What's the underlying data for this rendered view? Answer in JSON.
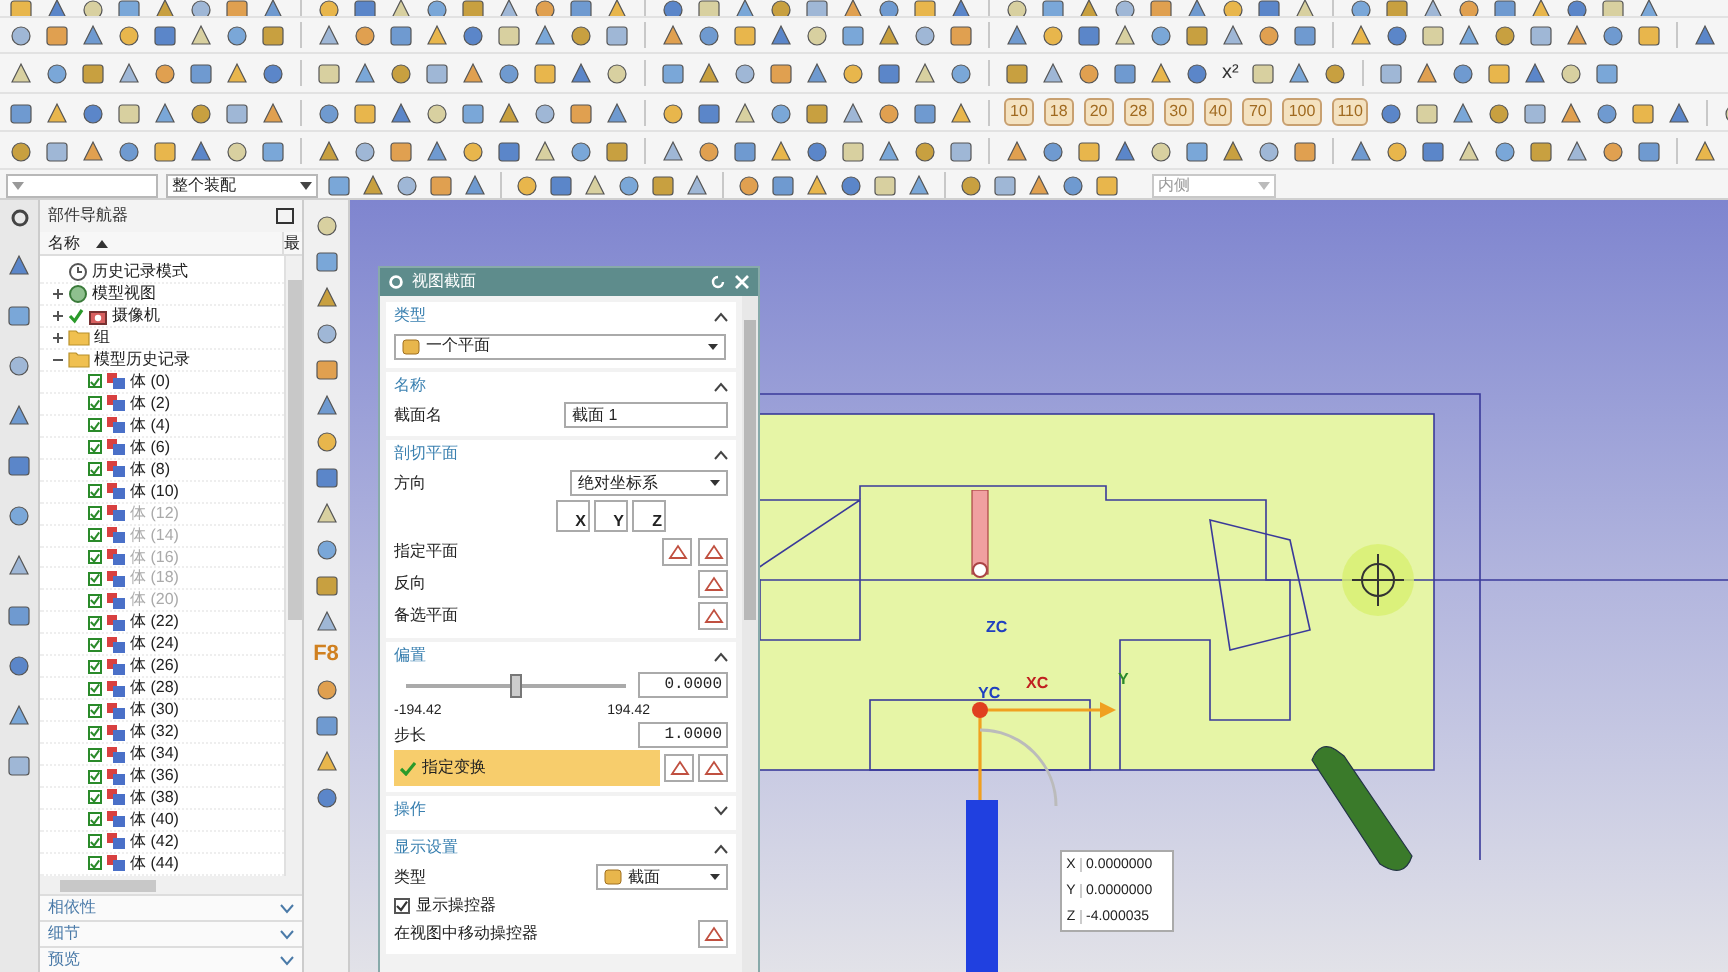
{
  "toolbars": {
    "number_buttons": [
      "10",
      "18",
      "20",
      "28",
      "30",
      "40",
      "70",
      "100",
      "110"
    ],
    "power_button": "x²"
  },
  "filter_bar": {
    "scope": "整个装配",
    "placement": "内侧"
  },
  "part_navigator": {
    "title": "部件导航器",
    "columns": [
      "名称",
      "最"
    ],
    "items": [
      {
        "label": "历史记录模式",
        "kind": "mode"
      },
      {
        "label": "模型视图",
        "kind": "views",
        "expanded": false
      },
      {
        "label": "摄像机",
        "kind": "camera",
        "expanded": false,
        "checked": true
      },
      {
        "label": "组",
        "kind": "folder",
        "expanded": false
      },
      {
        "label": "模型历史记录",
        "kind": "folder",
        "expanded": true,
        "children": [
          {
            "label": "体 (0)",
            "checked": true,
            "dimmed": false
          },
          {
            "label": "体 (2)",
            "checked": true,
            "dimmed": false
          },
          {
            "label": "体 (4)",
            "checked": true,
            "dimmed": false
          },
          {
            "label": "体 (6)",
            "checked": true,
            "dimmed": false
          },
          {
            "label": "体 (8)",
            "checked": true,
            "dimmed": false
          },
          {
            "label": "体 (10)",
            "checked": true,
            "dimmed": false
          },
          {
            "label": "体 (12)",
            "checked": true,
            "dimmed": true
          },
          {
            "label": "体 (14)",
            "checked": true,
            "dimmed": true
          },
          {
            "label": "体 (16)",
            "checked": true,
            "dimmed": true
          },
          {
            "label": "体 (18)",
            "checked": true,
            "dimmed": true
          },
          {
            "label": "体 (20)",
            "checked": true,
            "dimmed": true
          },
          {
            "label": "体 (22)",
            "checked": true,
            "dimmed": false
          },
          {
            "label": "体 (24)",
            "checked": true,
            "dimmed": false
          },
          {
            "label": "体 (26)",
            "checked": true,
            "dimmed": false
          },
          {
            "label": "体 (28)",
            "checked": true,
            "dimmed": false
          },
          {
            "label": "体 (30)",
            "checked": true,
            "dimmed": false
          },
          {
            "label": "体 (32)",
            "checked": true,
            "dimmed": false
          },
          {
            "label": "体 (34)",
            "checked": true,
            "dimmed": false
          },
          {
            "label": "体 (36)",
            "checked": true,
            "dimmed": false
          },
          {
            "label": "体 (38)",
            "checked": true,
            "dimmed": false
          },
          {
            "label": "体 (40)",
            "checked": true,
            "dimmed": false
          },
          {
            "label": "体 (42)",
            "checked": true,
            "dimmed": false
          },
          {
            "label": "体 (44)",
            "checked": true,
            "dimmed": false
          }
        ]
      }
    ],
    "panels": [
      {
        "label": "相依性",
        "expanded": false
      },
      {
        "label": "细节",
        "expanded": false
      },
      {
        "label": "预览",
        "expanded": false
      }
    ]
  },
  "vertical_toolbar": {
    "function_key": "F8"
  },
  "dialog": {
    "title": "视图截面",
    "type_section": {
      "title": "类型",
      "expanded": true,
      "value": "一个平面"
    },
    "name_section": {
      "title": "名称",
      "expanded": true,
      "label": "截面名",
      "value": "截面 1"
    },
    "plane_section": {
      "title": "剖切平面",
      "expanded": true,
      "orientation_label": "方向",
      "orientation": "绝对坐标系",
      "axes": [
        "X",
        "Y",
        "Z"
      ],
      "specify_plane": "指定平面",
      "reverse": "反向",
      "alternate_plane": "备选平面"
    },
    "offset_section": {
      "title": "偏置",
      "expanded": true,
      "level": 0.5,
      "value": "0.0000",
      "min": "-194.42",
      "max": "194.42",
      "step_label": "步长",
      "step": "1.0000",
      "transform": "指定变换",
      "transform_done": true
    },
    "operation_section": {
      "title": "操作",
      "expanded": false
    },
    "display_section": {
      "title": "显示设置",
      "expanded": true,
      "type_label": "类型",
      "type_value": "截面",
      "show_manipulator": "显示操控器",
      "show_manipulator_checked": true,
      "move_manipulator": "在视图中移动操控器"
    }
  },
  "viewport": {
    "axis_labels": {
      "z": "ZC",
      "y": "YC",
      "x": "XC",
      "y_handle": "Y"
    },
    "coordinates": [
      {
        "label": "X",
        "value": "0.0000000"
      },
      {
        "label": "Y",
        "value": "0.0000000"
      },
      {
        "label": "Z",
        "value": "-4.000035"
      }
    ]
  }
}
